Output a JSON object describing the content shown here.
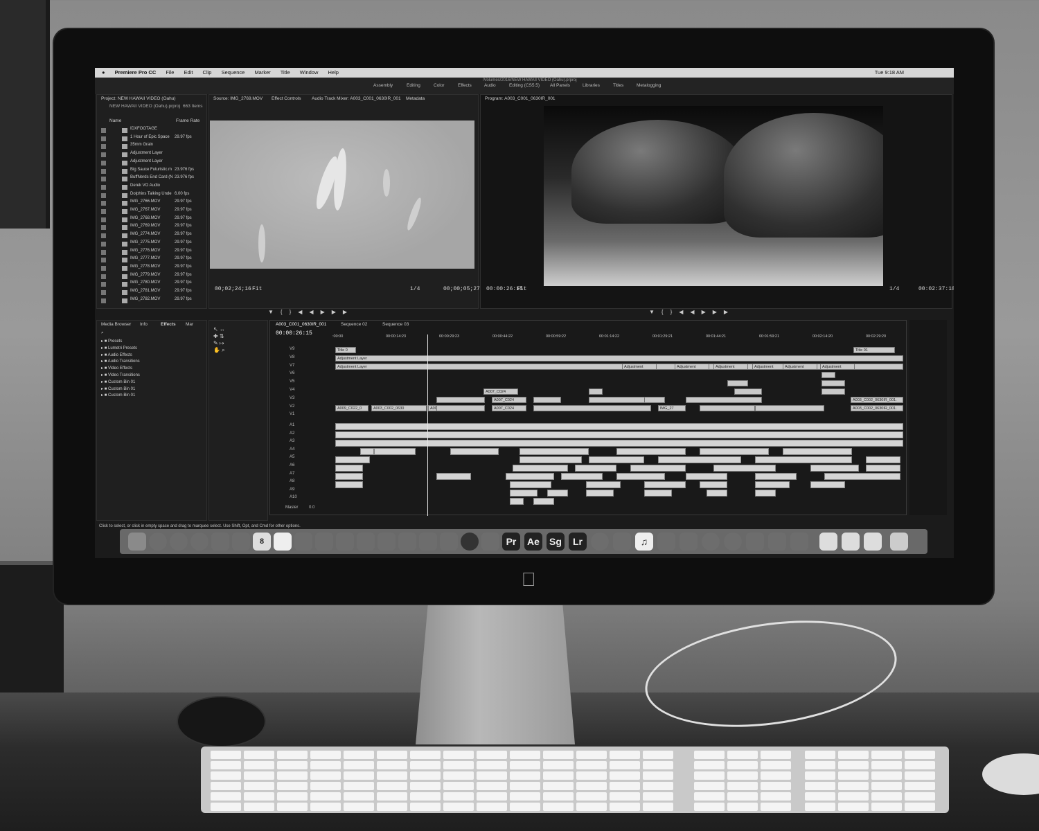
{
  "menubar": {
    "apple_logo": "apple-logo",
    "app_name": "Premiere Pro CC",
    "items": [
      "File",
      "Edit",
      "Clip",
      "Sequence",
      "Marker",
      "Title",
      "Window",
      "Help"
    ],
    "path": "/Volumes/2016/NEW HAWAII VIDEO (Oahu).prproj",
    "clock": "Tue 9:18 AM"
  },
  "workspaces": [
    "Assembly",
    "Editing",
    "Color",
    "Effects",
    "Audio",
    "Editing (CS5.5)",
    "All Panels",
    "Libraries",
    "Titles",
    "Metalogging"
  ],
  "project": {
    "title": "Project: NEW HAWAII VIDEO (Oahu)",
    "file": "NEW HAWAII VIDEO (Oahu).prproj",
    "count": "663 Items",
    "col_name": "Name",
    "col_rate": "Frame Rate",
    "items": [
      {
        "name": "IDXFOOTAGE",
        "rate": ""
      },
      {
        "name": "1 Hour of Epic Space",
        "rate": "29.97 fps"
      },
      {
        "name": "35mm Grain",
        "rate": ""
      },
      {
        "name": "Adjustment Layer",
        "rate": ""
      },
      {
        "name": "Adjustment Layer",
        "rate": ""
      },
      {
        "name": "Big Sauce Futuristic.m",
        "rate": "23.976 fps"
      },
      {
        "name": "BuffNerds End Card (N",
        "rate": "23.976 fps"
      },
      {
        "name": "Derek VO Audio",
        "rate": ""
      },
      {
        "name": "Dolphins Talking Unde",
        "rate": "6.00 fps"
      },
      {
        "name": "IMG_2766.MOV",
        "rate": "29.97 fps"
      },
      {
        "name": "IMG_2767.MOV",
        "rate": "29.97 fps"
      },
      {
        "name": "IMG_2768.MOV",
        "rate": "29.97 fps"
      },
      {
        "name": "IMG_2769.MOV",
        "rate": "29.97 fps"
      },
      {
        "name": "IMG_2774.MOV",
        "rate": "29.97 fps"
      },
      {
        "name": "IMG_2775.MOV",
        "rate": "29.97 fps"
      },
      {
        "name": "IMG_2776.MOV",
        "rate": "29.97 fps"
      },
      {
        "name": "IMG_2777.MOV",
        "rate": "29.97 fps"
      },
      {
        "name": "IMG_2778.MOV",
        "rate": "29.97 fps"
      },
      {
        "name": "IMG_2779.MOV",
        "rate": "29.97 fps"
      },
      {
        "name": "IMG_2780.MOV",
        "rate": "29.97 fps"
      },
      {
        "name": "IMG_2781.MOV",
        "rate": "29.97 fps"
      },
      {
        "name": "IMG_2782.MOV",
        "rate": "29.97 fps"
      }
    ]
  },
  "source": {
    "tabs": [
      "Source: IMG_2769.MOV",
      "Effect Controls",
      "Audio Track Mixer: A003_C001_0630IR_001",
      "Metadata"
    ],
    "timecode_in": "00;02;24;16",
    "fit": "Fit",
    "zoom": "1/4",
    "timecode_dur": "00;00;05;27"
  },
  "program": {
    "title": "Program: A003_C001_0630IR_001",
    "timecode_in": "00:00:26:15",
    "fit": "Fit",
    "zoom": "1/4",
    "timecode_dur": "00:02:37:10"
  },
  "effects": {
    "tabs": [
      "Media Browser",
      "Info",
      "Effects",
      "Mar"
    ],
    "items": [
      "Presets",
      "Lumetri Presets",
      "Audio Effects",
      "Audio Transitions",
      "Video Effects",
      "Video Transitions",
      "Custom Bin 01",
      "Custom Bin 01",
      "Custom Bin 01"
    ]
  },
  "timeline": {
    "tabs": [
      "A003_C001_0630IR_001",
      "Sequence 02",
      "Sequence 03"
    ],
    "timecode": "00:00:26:15",
    "ruler": [
      ":00:00",
      "00:00:14:23",
      "00:00:29:23",
      "00:00:44:22",
      "00:00:59:22",
      "00:01:14:22",
      "00:01:29:21",
      "00:01:44:21",
      "00:01:59:21",
      "00:02:14:20",
      "00:02:29:20"
    ],
    "video_tracks": [
      "V9",
      "V8",
      "V7",
      "V6",
      "V5",
      "V4",
      "V3",
      "V2",
      "V1"
    ],
    "audio_tracks": [
      "A1",
      "A2",
      "A3",
      "A4",
      "A5",
      "A6",
      "A7",
      "A8",
      "A9",
      "A10"
    ],
    "master": "Master",
    "master_val": "0.0",
    "clip_labels": {
      "title": "Title 0",
      "title_end": "Title 01",
      "adj1": "Adjustment Layer",
      "adj2": "Adjustment Layer",
      "adj_small": "Adjustment",
      "a009": "A009_C022_0",
      "a003a": "A003_C002_0630",
      "a003b": "A003_C",
      "a007a": "A007_C024",
      "a007b": "A007_C024",
      "a003c": "A003_C002_0630IR_001.",
      "a003d": "A003_C002_0630IR_001.",
      "img": "IMG_27"
    }
  },
  "status_text": "Click to select, or click in empty space and drag to marquee select. Use Shift, Opt, and Cmd for other options.",
  "dock": {
    "apps": [
      "Pr",
      "Ae",
      "Sg",
      "Lr"
    ]
  }
}
